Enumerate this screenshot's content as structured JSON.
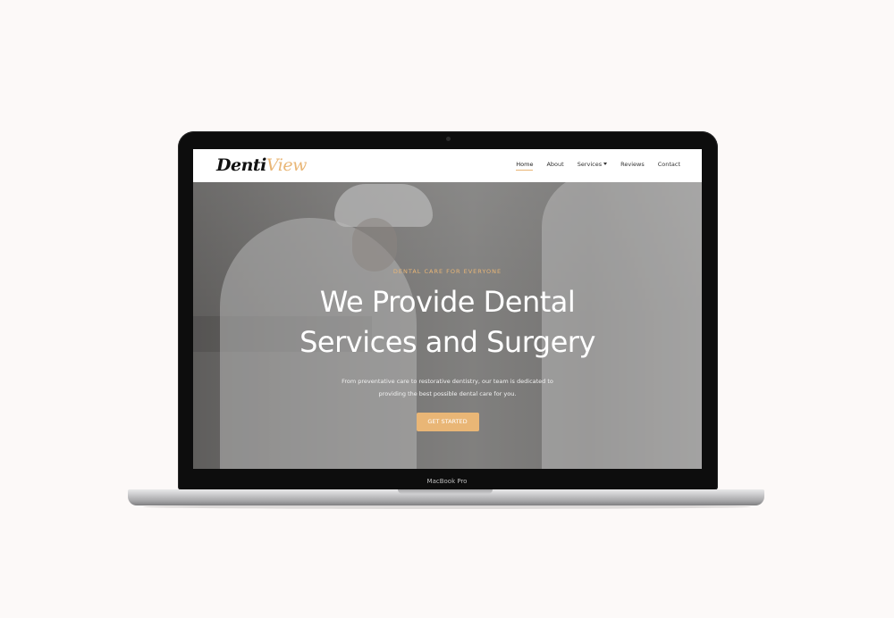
{
  "device": {
    "model_label": "MacBook Pro"
  },
  "site": {
    "logo": {
      "part1": "Denti",
      "part2": "View",
      "accent_color": "#e9b676"
    },
    "nav": [
      {
        "label": "Home",
        "active": true
      },
      {
        "label": "About"
      },
      {
        "label": "Services",
        "has_dropdown": true
      },
      {
        "label": "Reviews"
      },
      {
        "label": "Contact"
      }
    ]
  },
  "hero": {
    "eyebrow": "DENTAL CARE FOR EVERYONE",
    "headline": "We Provide Dental Services and Surgery",
    "subtext": "From preventative care to restorative dentistry, our team is dedicated to providing the best possible dental care for you.",
    "cta_label": "GET STARTED"
  },
  "colors": {
    "accent": "#e9b676",
    "background": "#fcf9f8"
  }
}
